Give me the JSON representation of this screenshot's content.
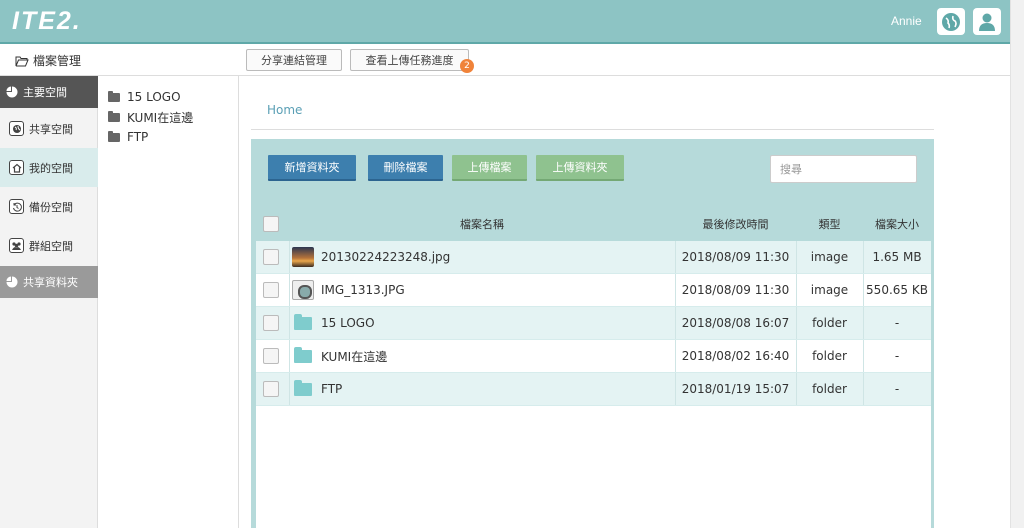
{
  "header": {
    "logo": "ITE2.",
    "user_name": "Annie"
  },
  "subbar": {
    "title": "檔案管理",
    "share_link_btn": "分享連結管理",
    "upload_progress_btn": "查看上傳任務進度",
    "upload_badge": "2"
  },
  "nav": {
    "main_space": "主要空間",
    "items": [
      {
        "label": "共享空間"
      },
      {
        "label": "我的空間"
      },
      {
        "label": "備份空間"
      },
      {
        "label": "群組空間"
      }
    ],
    "shared_folder": "共享資料夾"
  },
  "tree": {
    "items": [
      {
        "label": "15 LOGO"
      },
      {
        "label": "KUMI在這邊"
      },
      {
        "label": "FTP"
      }
    ]
  },
  "main": {
    "breadcrumb": "Home",
    "actions": {
      "new_folder": "新增資料夾",
      "delete_file": "刪除檔案",
      "upload_file": "上傳檔案",
      "upload_folder": "上傳資料夾"
    },
    "search_placeholder": "搜尋",
    "columns": {
      "name": "檔案名稱",
      "modified": "最後修改時間",
      "type": "類型",
      "size": "檔案大小"
    },
    "rows": [
      {
        "name": "20130224223248.jpg",
        "modified": "2018/08/09 11:30",
        "type": "image",
        "size": "1.65 MB",
        "icon": "image-thumb-icon"
      },
      {
        "name": "IMG_1313.JPG",
        "modified": "2018/08/09 11:30",
        "type": "image",
        "size": "550.65 KB",
        "icon": "image-thumb-icon"
      },
      {
        "name": "15 LOGO",
        "modified": "2018/08/08 16:07",
        "type": "folder",
        "size": "-",
        "icon": "folder-icon"
      },
      {
        "name": "KUMI在這邊",
        "modified": "2018/08/02 16:40",
        "type": "folder",
        "size": "-",
        "icon": "folder-icon"
      },
      {
        "name": "FTP",
        "modified": "2018/01/19 15:07",
        "type": "folder",
        "size": "-",
        "icon": "folder-icon"
      }
    ]
  },
  "colors": {
    "header_bg": "#8dc4c4",
    "panel_bg": "#b6dada",
    "row_alt": "#e4f3f3",
    "btn_blue": "#3d7fae",
    "btn_green": "#8fc28f",
    "badge": "#f0833a"
  }
}
